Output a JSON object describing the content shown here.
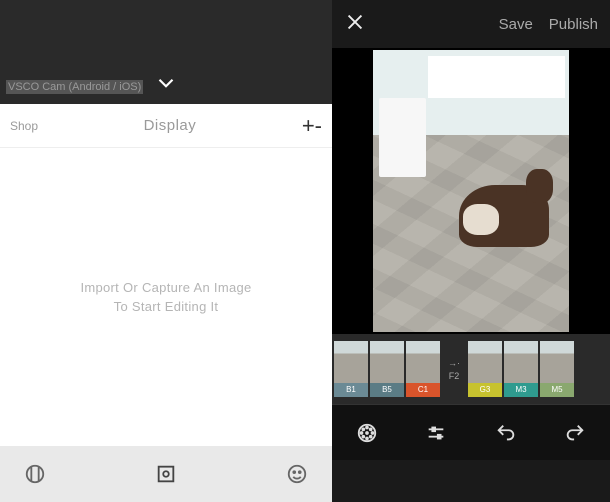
{
  "left": {
    "overlay_caption": "VSCO Cam (Android / iOS)",
    "header": {
      "shop": "Shop",
      "display": "Display",
      "add": "+-"
    },
    "empty_line1": "Import Or Capture An Image",
    "empty_line2": "To Start Editing It"
  },
  "right": {
    "actions": {
      "save": "Save",
      "publish": "Publish"
    },
    "filters": [
      {
        "id": "B1",
        "label": "B1",
        "color": "#6b8a95"
      },
      {
        "id": "B5",
        "label": "B5",
        "color": "#5b7c85"
      },
      {
        "id": "C1",
        "label": "C1",
        "color": "#d9542b"
      },
      {
        "id": "sep",
        "label": "F2",
        "is_sep": true
      },
      {
        "id": "G3",
        "label": "G3",
        "color": "#c7c22f"
      },
      {
        "id": "M3",
        "label": "M3",
        "color": "#2f9b8f"
      },
      {
        "id": "M5",
        "label": "M5",
        "color": "#8aa86f"
      }
    ]
  }
}
